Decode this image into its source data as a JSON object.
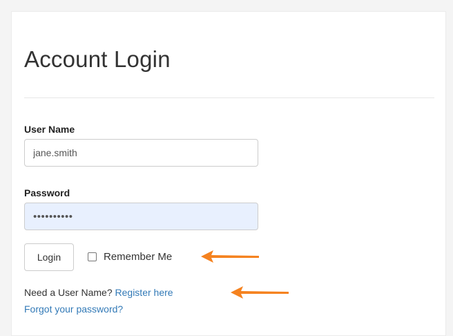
{
  "login_form": {
    "title": "Account Login",
    "username": {
      "label": "User Name",
      "value": "jane.smith"
    },
    "password": {
      "label": "Password",
      "value": "••••••••••"
    },
    "login_button": "Login",
    "remember_me": {
      "label": "Remember Me",
      "checked": false
    },
    "register_prompt": "Need a User Name?",
    "register_link": "Register here",
    "forgot_link": "Forgot your password?"
  },
  "annotations": {
    "arrow_color": "#f5821f"
  }
}
